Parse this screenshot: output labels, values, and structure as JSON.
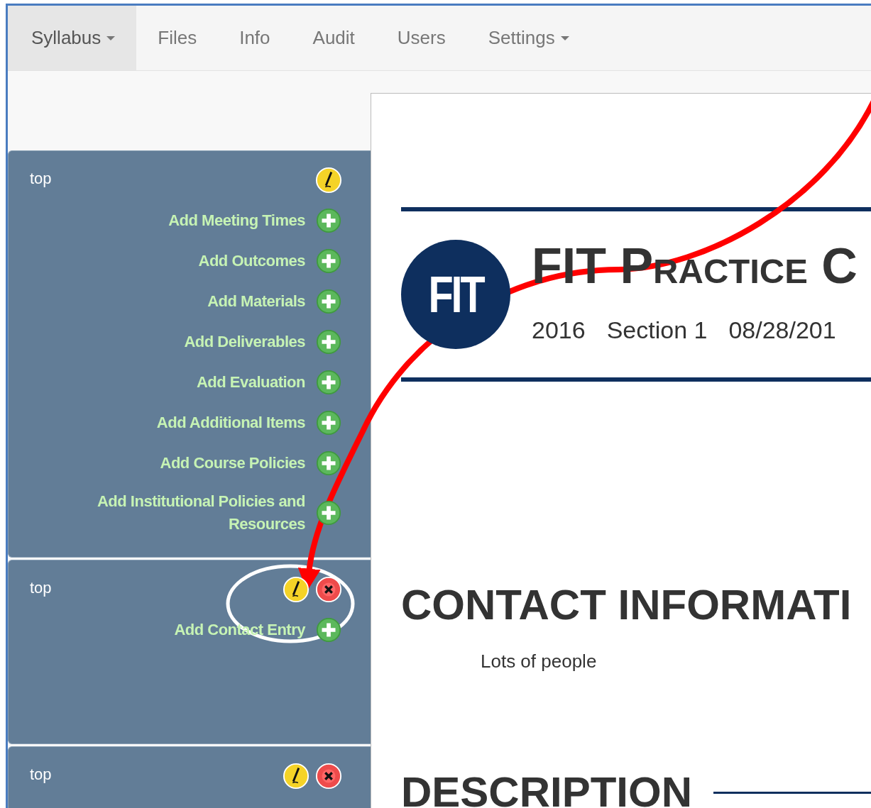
{
  "nav": {
    "items": [
      {
        "label": "Syllabus",
        "selected": true,
        "dropdown": true
      },
      {
        "label": "Files",
        "selected": false,
        "dropdown": false
      },
      {
        "label": "Info",
        "selected": false,
        "dropdown": false
      },
      {
        "label": "Audit",
        "selected": false,
        "dropdown": false
      },
      {
        "label": "Users",
        "selected": false,
        "dropdown": false
      },
      {
        "label": "Settings",
        "selected": false,
        "dropdown": true
      }
    ]
  },
  "sidebar": {
    "panels": [
      {
        "label": "top",
        "actions": [
          {
            "kind": "edit"
          }
        ],
        "links": [
          "Add Meeting Times",
          "Add Outcomes",
          "Add Materials",
          "Add Deliverables",
          "Add Evaluation",
          "Add Additional Items",
          "Add Course Policies",
          "Add Institutional Policies and Resources"
        ]
      },
      {
        "label": "top",
        "actions": [
          {
            "kind": "edit"
          },
          {
            "kind": "delete"
          }
        ],
        "links": [
          "Add Contact Entry"
        ]
      },
      {
        "label": "top",
        "actions": [
          {
            "kind": "edit"
          },
          {
            "kind": "delete"
          }
        ]
      }
    ]
  },
  "document": {
    "logo": "FIT",
    "title": "FIT Practice C",
    "subtitle": [
      "2016",
      "Section 1",
      "08/28/201"
    ],
    "sections": [
      {
        "heading": "CONTACT INFORMATI",
        "rule": false,
        "body": "Lots of people"
      },
      {
        "heading": "DESCRIPTION",
        "rule": true
      }
    ]
  }
}
